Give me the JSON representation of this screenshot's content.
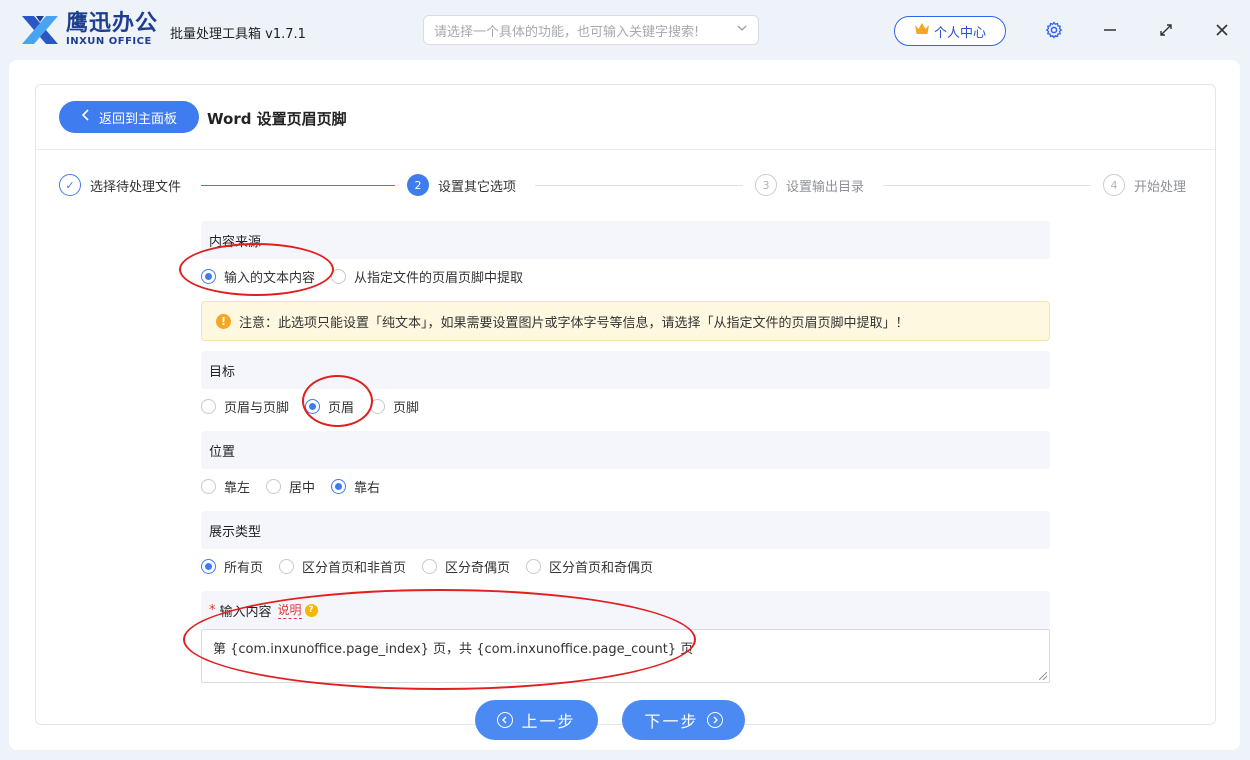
{
  "app": {
    "logo_cn": "鹰迅办公",
    "logo_en": "INXUN OFFICE",
    "title": "批量处理工具箱 v1.7.1",
    "search_placeholder": "请选择一个具体的功能，也可输入关键字搜索!",
    "user_center": "个人中心"
  },
  "header": {
    "back_label": "返回到主面板",
    "page_title": "Word 设置页眉页脚"
  },
  "steps": [
    {
      "num": "✓",
      "label": "选择待处理文件",
      "state": "done"
    },
    {
      "num": "2",
      "label": "设置其它选项",
      "state": "active"
    },
    {
      "num": "3",
      "label": "设置输出目录",
      "state": "todo"
    },
    {
      "num": "4",
      "label": "开始处理",
      "state": "todo"
    }
  ],
  "content_source": {
    "heading": "内容来源",
    "options": [
      "输入的文本内容",
      "从指定文件的页眉页脚中提取"
    ],
    "selected": 0
  },
  "notice": "注意：此选项只能设置「纯文本」，如果需要设置图片或字体字号等信息，请选择「从指定文件的页眉页脚中提取」！",
  "target": {
    "heading": "目标",
    "options": [
      "页眉与页脚",
      "页眉",
      "页脚"
    ],
    "selected": 1
  },
  "position": {
    "heading": "位置",
    "options": [
      "靠左",
      "居中",
      "靠右"
    ],
    "selected": 2
  },
  "display_type": {
    "heading": "展示类型",
    "options": [
      "所有页",
      "区分首页和非首页",
      "区分奇偶页",
      "区分首页和奇偶页"
    ],
    "selected": 0
  },
  "input": {
    "required_mark": "*",
    "heading": "输入内容",
    "help_link": "说明",
    "help_icon": "?",
    "value": "第 {com.inxunoffice.page_index} 页，共 {com.inxunoffice.page_count} 页"
  },
  "nav": {
    "prev": "上一步",
    "next": "下一步"
  },
  "colors": {
    "accent": "#3f7cf0",
    "annotation": "#e02020"
  }
}
